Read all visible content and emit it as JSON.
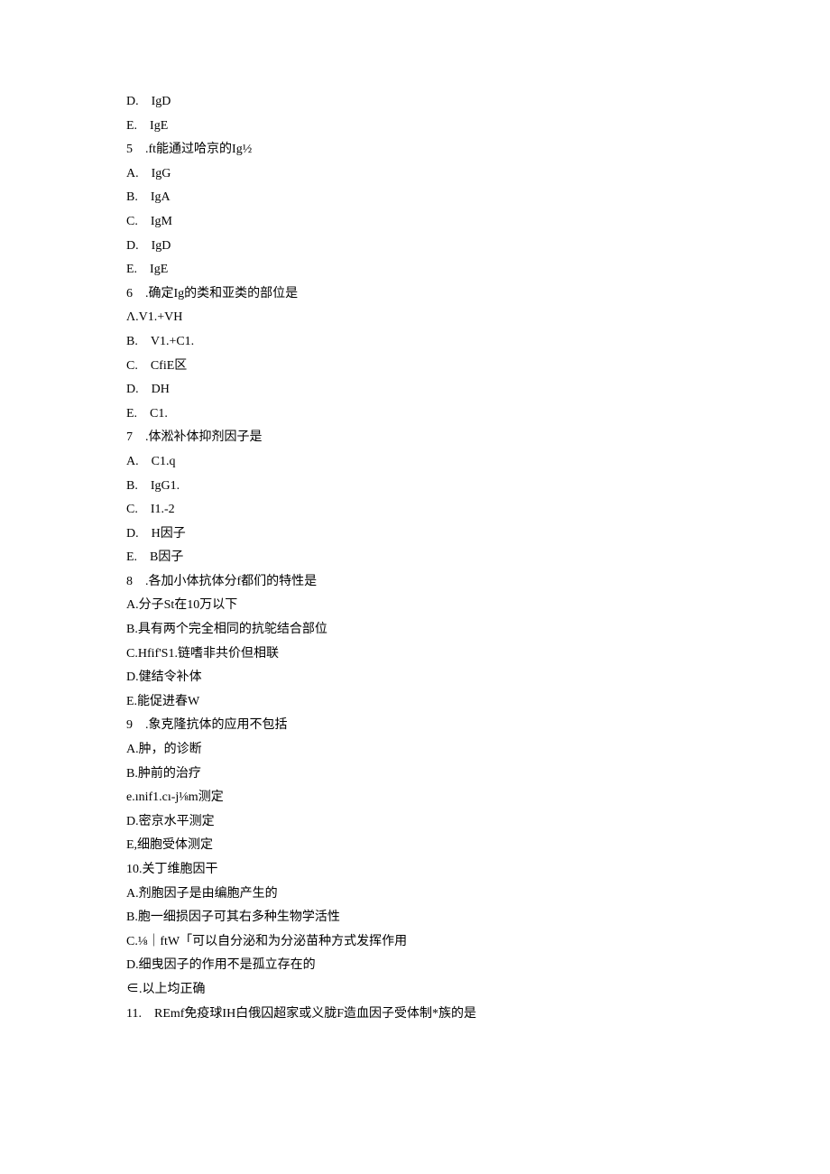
{
  "lines": [
    "D.　IgD",
    "E.　IgE",
    "5　.ft能通过哈京的Ig½",
    "A.　IgG",
    "B.　IgA",
    "C.　IgM",
    "D.　IgD",
    "E.　IgE",
    "6　.确定Ig的类和亚类的部位是",
    "Λ.V1.+VH",
    "B.　V1.+C1.",
    "C.　CfiE区",
    "D.　DH",
    "E.　C1.",
    "7　.体淞补体抑剂因子是",
    "A.　C1.q",
    "B.　IgG1.",
    "C.　I1.-2",
    "D.　H因子",
    "E.　B因子",
    "8　.各加小体抗体分f都们的特性是",
    "A.分子St在10万以下",
    "B.具有两个完全相同的抗鸵结合部位",
    "C.Hfif'S1.链嗜非共价但相联",
    "D.健结令补体",
    "E.能促进春W",
    "9　.象克隆抗体的应用不包括",
    "A.肿，的诊断",
    "B.肿前的治疗",
    "e.ınif1.cı-j⅛m测定",
    "D.密京水平测定",
    "E,细胞受体测定",
    "10.关丁维胞因干",
    "A.剂胞因子是由编胞产生的",
    "B.胞一细损因子可其右多种生物学活性",
    "C.⅛｜ftW「可以自分泌和为分泌苗种方式发挥作用",
    "D.细曳因子的作用不是孤立存在的",
    "∈.以上均正确",
    "11.　REmf免疫球IH白俄囚超家或义胧F造血因子受体制*族的是"
  ]
}
